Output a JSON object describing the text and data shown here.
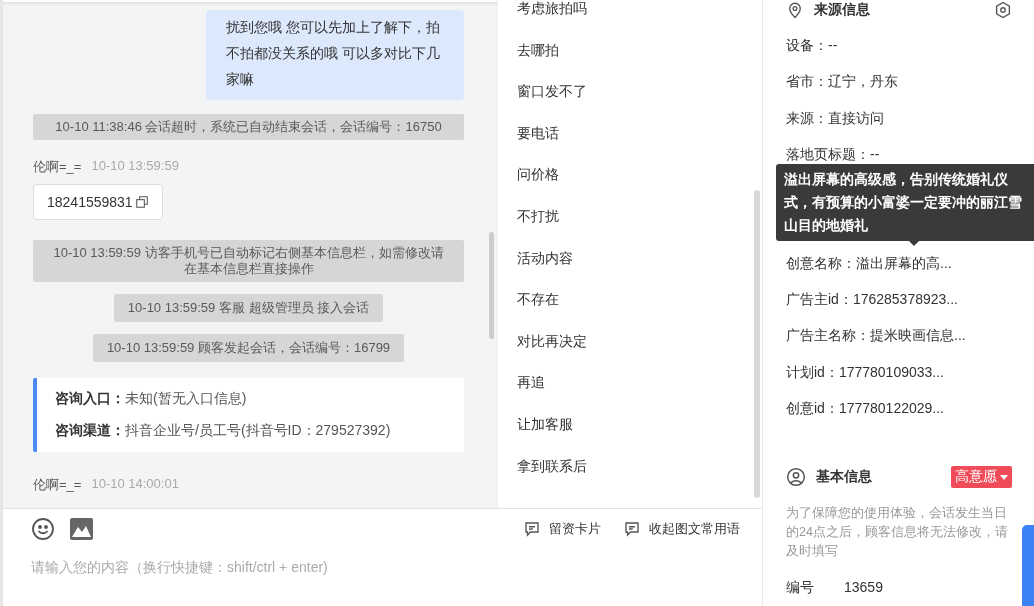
{
  "chat": {
    "messages": [
      {
        "kind": "bubble",
        "text": "扰到您哦 您可以先加上了解下，拍不拍都没关系的哦 可以多对比下几家嘛"
      },
      {
        "kind": "system",
        "wide": true,
        "text": "10-10 11:38:46 会话超时，系统已自动结束会话，会话编号：16750"
      },
      {
        "kind": "sender",
        "name": "伦啊=_=",
        "time": "10-10 13:59:59"
      },
      {
        "kind": "phone",
        "text": "18241559831"
      },
      {
        "kind": "system",
        "wide": true,
        "text": "10-10 13:59:59 访客手机号已自动标记右侧基本信息栏，如需修改请在基本信息栏直接操作"
      },
      {
        "kind": "system",
        "wide": false,
        "text": "10-10 13:59:59 客服 超级管理员 接入会话"
      },
      {
        "kind": "system",
        "wide": false,
        "text": "10-10 13:59:59 顾客发起会话，会话编号：16799"
      },
      {
        "kind": "info",
        "rows": [
          {
            "label": "咨询入口：",
            "value": "未知(暂无入口信息)"
          },
          {
            "label": "咨询渠道：",
            "value": "抖音企业号/员工号(抖音号ID：279527392)"
          }
        ]
      },
      {
        "kind": "sender",
        "name": "伦啊=_=",
        "time": "10-10 14:00:01"
      }
    ]
  },
  "quick_replies": [
    "考虑旅拍吗",
    "去哪拍",
    "窗口发不了",
    "要电话",
    "问价格",
    "不打扰",
    "活动内容",
    "不存在",
    "对比再决定",
    "再追",
    "让加客服",
    "拿到联系后"
  ],
  "composer": {
    "actions": [
      "留资卡片",
      "收起图文常用语"
    ],
    "placeholder": "请输入您的内容（换行快捷键：shift/ctrl + enter)"
  },
  "source_info": {
    "title": "来源信息",
    "items": [
      "设备：--",
      "省市：辽宁，丹东",
      "来源：直接访问",
      "落地页标题：--",
      "创意名称：溢出屏幕的高...",
      "广告主id：176285378923...",
      "广告主名称：提米映画信息...",
      "计划id：177780109033...",
      "创意id：177780122029..."
    ],
    "tooltip": "溢出屏幕的高级感，告别传统婚礼仪式，有预算的小富婆一定要冲的丽江雪山目的地婚礼"
  },
  "basic_info": {
    "title": "基本信息",
    "intent": "高意愿",
    "notice": "为了保障您的使用体验，会话发生当日的24点之后，顾客信息将无法修改，请及时填写",
    "fields": [
      {
        "label": "编号",
        "value": "13659"
      }
    ]
  }
}
